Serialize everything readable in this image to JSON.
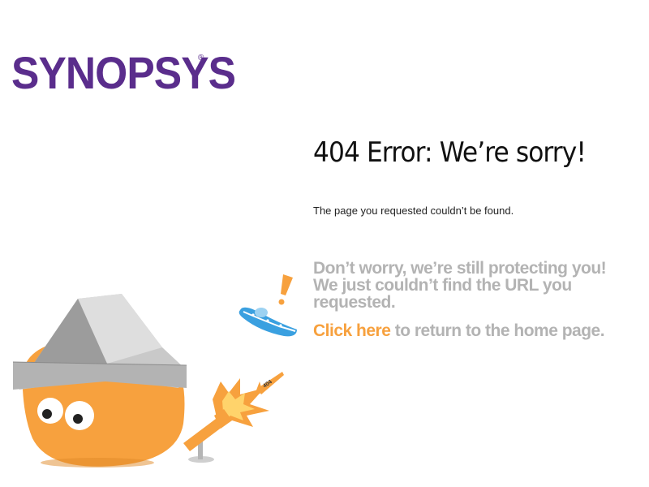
{
  "logo": {
    "text": "SYNOPSYS",
    "registered": "®",
    "color": "#5a2d8c"
  },
  "error": {
    "headline": "404 Error: We’re sorry!",
    "message": "The page you requested couldn’t be found."
  },
  "reassurance": {
    "text": "Don’t worry, we’re still protecting you! We just couldn’t find the URL you requested."
  },
  "home_link": {
    "label": "Click here",
    "suffix": " to return to the home page.",
    "color": "#f7a13e"
  },
  "illustration": {
    "mascot_icon": "orange-blob-mascot-icon",
    "hat_icon": "foil-hat-icon",
    "ufo_icon": "ufo-icon",
    "exclamation_icon": "exclamation-icon",
    "rocket_label": "404",
    "cannon_icon": "cannon-icon"
  },
  "colors": {
    "orange": "#f7a13e",
    "gray_text": "#b3b3b3",
    "ufo_blue": "#3aa0e0"
  }
}
